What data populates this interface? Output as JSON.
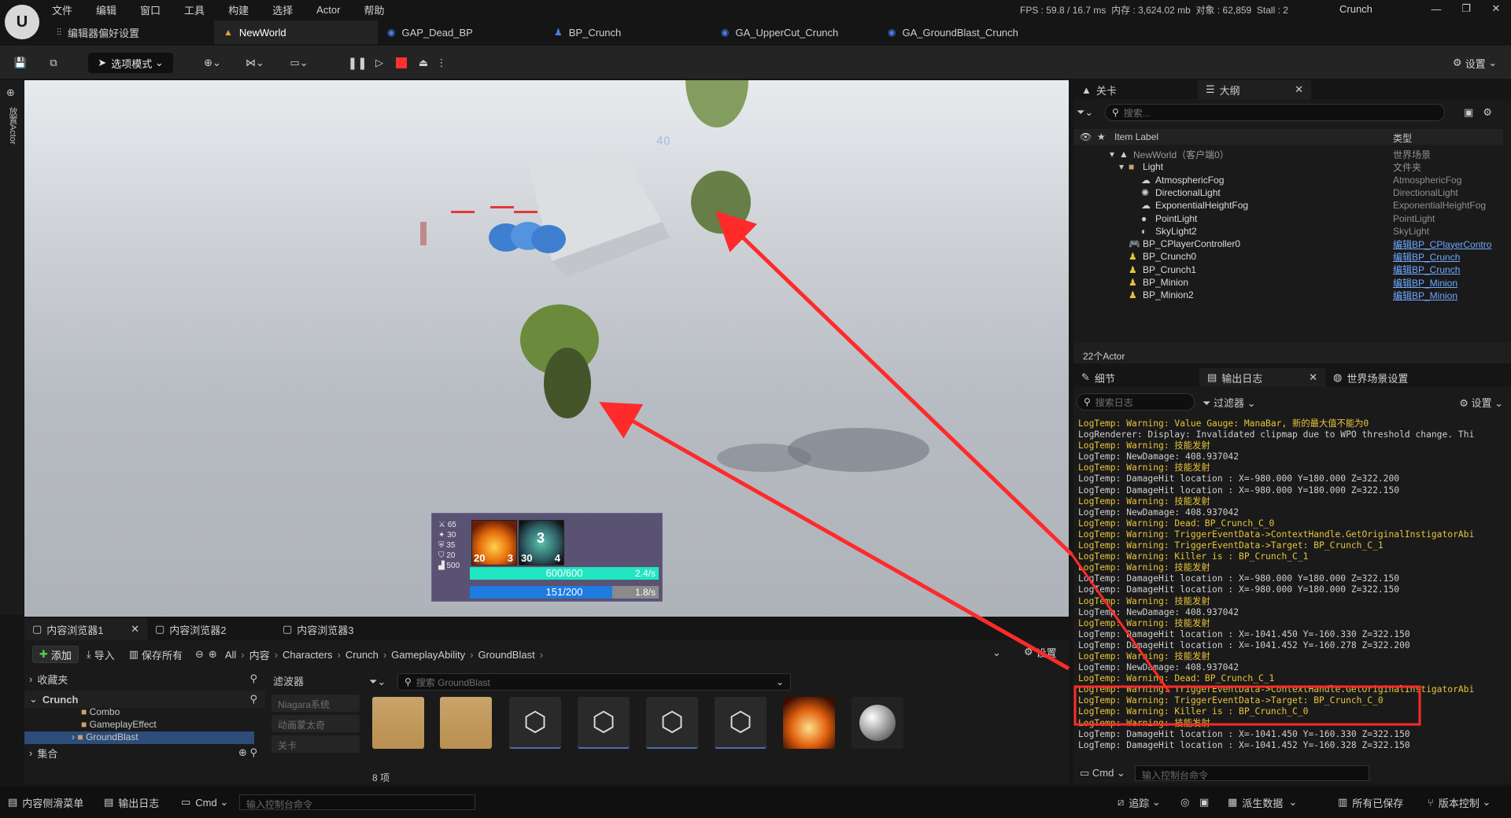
{
  "app": {
    "logo": "U",
    "project_name": "Crunch"
  },
  "menu": [
    "文件",
    "编辑",
    "窗口",
    "工具",
    "构建",
    "选择",
    "Actor",
    "帮助"
  ],
  "stats": {
    "fps_label": "FPS :",
    "fps": "59.8",
    "ms": "16.7 ms",
    "mem_label": "内存 :",
    "mem": "3,624.02 mb",
    "obj_label": "对象 :",
    "obj": "62,859",
    "stall_label": "Stall :",
    "stall": "2"
  },
  "window_controls": [
    "—",
    "❐",
    "✕"
  ],
  "doc_tabs": [
    {
      "label": "编辑器偏好设置",
      "icon": "sliders-icon"
    },
    {
      "label": "NewWorld",
      "icon": "level-icon",
      "active": true
    },
    {
      "label": "GAP_Dead_BP",
      "icon": "ability-icon"
    },
    {
      "label": "BP_Crunch",
      "icon": "character-icon"
    },
    {
      "label": "GA_UpperCut_Crunch",
      "icon": "ability-icon"
    },
    {
      "label": "GA_GroundBlast_Crunch",
      "icon": "ability-icon"
    }
  ],
  "toolbar": {
    "mode": "选项模式",
    "settings": "设置"
  },
  "left_rail": {
    "place_actor": "放置Actor"
  },
  "hud": {
    "stats": [
      "65",
      "30",
      "35",
      "20",
      "500"
    ],
    "skill1": {
      "level": "20",
      "cost": "3"
    },
    "skill2": {
      "cooldown": "3",
      "level": "30",
      "cost": "4"
    },
    "health": {
      "text": "600/600",
      "rate": "2.4/s",
      "fraction": 1.0
    },
    "mana": {
      "text": "151/200",
      "rate": "1.8/s",
      "fraction": 0.755
    },
    "viewport_floating_text": "40"
  },
  "outliner": {
    "tabs": [
      {
        "label": "关卡"
      },
      {
        "label": "大纲",
        "active": true
      }
    ],
    "search_placeholder": "搜索...",
    "columns": {
      "label": "Item Label",
      "type": "类型"
    },
    "rows": [
      {
        "label": "NewWorld（客户端0）",
        "type": "世界场景",
        "indent": 0
      },
      {
        "label": "Light",
        "type": "文件夹",
        "indent": 1
      },
      {
        "label": "AtmosphericFog",
        "type": "AtmosphericFog",
        "indent": 2
      },
      {
        "label": "DirectionalLight",
        "type": "DirectionalLight",
        "indent": 2
      },
      {
        "label": "ExponentialHeightFog",
        "type": "ExponentialHeightFog",
        "indent": 2
      },
      {
        "label": "PointLight",
        "type": "PointLight",
        "indent": 2
      },
      {
        "label": "SkyLight2",
        "type": "SkyLight",
        "indent": 2
      },
      {
        "label": "BP_CPlayerController0",
        "type": "编辑BP_CPlayerContro",
        "indent": 1,
        "link": true
      },
      {
        "label": "BP_Crunch0",
        "type": "编辑BP_Crunch",
        "indent": 1,
        "link": true
      },
      {
        "label": "BP_Crunch1",
        "type": "编辑BP_Crunch",
        "indent": 1,
        "link": true
      },
      {
        "label": "BP_Minion",
        "type": "编辑BP_Minion",
        "indent": 1,
        "link": true
      },
      {
        "label": "BP_Minion2",
        "type": "编辑BP_Minion",
        "indent": 1,
        "link": true
      }
    ],
    "actor_count": "22个Actor"
  },
  "output": {
    "tabs": [
      {
        "label": "细节"
      },
      {
        "label": "输出日志",
        "active": true
      },
      {
        "label": "世界场景设置"
      }
    ],
    "search_placeholder": "搜索日志",
    "filter": "过滤器",
    "settings": "设置",
    "cmd": "Cmd",
    "cmd_placeholder": "输入控制台命令",
    "lines": [
      {
        "t": "LogTemp: Warning: Value Gauge: ManaBar, 新的最大值不能为0",
        "w": true
      },
      {
        "t": "LogRenderer: Display: Invalidated clipmap due to WPO threshold change. Thi",
        "w": false
      },
      {
        "t": "LogTemp: Warning: 技能发射",
        "w": true
      },
      {
        "t": "LogTemp: NewDamage: 408.937042",
        "w": false
      },
      {
        "t": "LogTemp: Warning: 技能发射",
        "w": true
      },
      {
        "t": "LogTemp: DamageHit location : X=-980.000 Y=180.000 Z=322.200",
        "w": false
      },
      {
        "t": "LogTemp: DamageHit location : X=-980.000 Y=180.000 Z=322.150",
        "w": false
      },
      {
        "t": "LogTemp: Warning: 技能发射",
        "w": true
      },
      {
        "t": "LogTemp: NewDamage: 408.937042",
        "w": false
      },
      {
        "t": "LogTemp: Warning: Dead：BP_Crunch_C_0",
        "w": true
      },
      {
        "t": "LogTemp: Warning: TriggerEventData->ContextHandle.GetOriginalInstigatorAbi",
        "w": true
      },
      {
        "t": "LogTemp: Warning: TriggerEventData->Target: BP_Crunch_C_1",
        "w": true
      },
      {
        "t": "LogTemp: Warning: Killer is : BP_Crunch_C_1",
        "w": true
      },
      {
        "t": "LogTemp: Warning: 技能发射",
        "w": true
      },
      {
        "t": "LogTemp: DamageHit location : X=-980.000 Y=180.000 Z=322.150",
        "w": false
      },
      {
        "t": "LogTemp: DamageHit location : X=-980.000 Y=180.000 Z=322.150",
        "w": false
      },
      {
        "t": "LogTemp: Warning: 技能发射",
        "w": true
      },
      {
        "t": "LogTemp: NewDamage: 408.937042",
        "w": false
      },
      {
        "t": "LogTemp: Warning: 技能发射",
        "w": true
      },
      {
        "t": "LogTemp: DamageHit location : X=-1041.450 Y=-160.330 Z=322.150",
        "w": false
      },
      {
        "t": "LogTemp: DamageHit location : X=-1041.452 Y=-160.278 Z=322.200",
        "w": false
      },
      {
        "t": "LogTemp: Warning: 技能发射",
        "w": true
      },
      {
        "t": "LogTemp: NewDamage: 408.937042",
        "w": false
      },
      {
        "t": "LogTemp: Warning: Dead：BP_Crunch_C_1",
        "w": true
      },
      {
        "t": "LogTemp: Warning: TriggerEventData->ContextHandle.GetOriginalInstigatorAbi",
        "w": true
      },
      {
        "t": "LogTemp: Warning: TriggerEventData->Target: BP_Crunch_C_0",
        "w": true
      },
      {
        "t": "LogTemp: Warning: Killer is : BP_Crunch_C_0",
        "w": true
      },
      {
        "t": "LogTemp: Warning: 技能发射",
        "w": true
      },
      {
        "t": "LogTemp: DamageHit location : X=-1041.450 Y=-160.330 Z=322.150",
        "w": false
      },
      {
        "t": "LogTemp: DamageHit location : X=-1041.452 Y=-160.328 Z=322.150",
        "w": false
      }
    ]
  },
  "content_browser": {
    "tabs": [
      {
        "label": "内容浏览器1",
        "active": true
      },
      {
        "label": "内容浏览器2"
      },
      {
        "label": "内容浏览器3"
      }
    ],
    "add": "添加",
    "import": "导入",
    "save_all": "保存所有",
    "settings": "设置",
    "breadcrumbs": [
      "All",
      "内容",
      "Characters",
      "Crunch",
      "GameplayAbility",
      "GroundBlast"
    ],
    "favorites": "收藏夹",
    "tree_root": "Crunch",
    "tree_items": [
      "Combo",
      "GameplayEffect",
      "GroundBlast"
    ],
    "collections": "集合",
    "filters_title": "滤波器",
    "filters": [
      "Niagara系统",
      "动画蒙太奇",
      "关卡"
    ],
    "asset_search_placeholder": "搜索 GroundBlast",
    "item_count": "8 项"
  },
  "statusbar": {
    "content_drawer": "内容侧滑菜单",
    "output_log": "输出日志",
    "cmd": "Cmd",
    "cmd_placeholder": "输入控制台命令",
    "trace": "追踪",
    "derived_data": "派生数据",
    "all_saved": "所有已保存",
    "source_control": "版本控制"
  },
  "colors": {
    "accent": "#2a90ff",
    "warning": "#e8c43a",
    "highlight_box": "#ff2a2a",
    "health": "#21e6c2",
    "mana": "#1f7be0"
  }
}
